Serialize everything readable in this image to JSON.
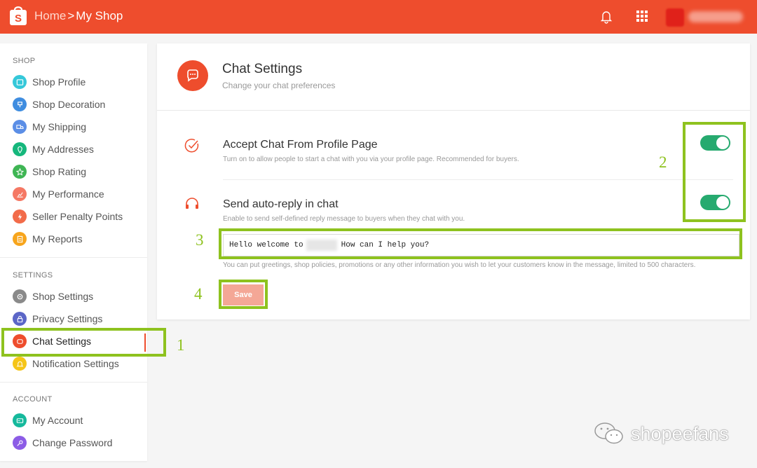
{
  "header": {
    "breadcrumb_home": "Home",
    "breadcrumb_sep": ">",
    "breadcrumb_current": "My Shop"
  },
  "sidebar": {
    "sections": [
      {
        "title": "SHOP",
        "items": [
          {
            "label": "Shop Profile",
            "icon": "profile-icon",
            "color": "#35c8d9"
          },
          {
            "label": "Shop Decoration",
            "icon": "brush-icon",
            "color": "#3f8de0"
          },
          {
            "label": "My Shipping",
            "icon": "truck-icon",
            "color": "#5b8ee6"
          },
          {
            "label": "My Addresses",
            "icon": "location-icon",
            "color": "#15b77c"
          },
          {
            "label": "Shop Rating",
            "icon": "star-icon",
            "color": "#3fb554"
          },
          {
            "label": "My Performance",
            "icon": "chart-icon",
            "color": "#f57864"
          },
          {
            "label": "Seller Penalty Points",
            "icon": "penalty-icon",
            "color": "#f26b49"
          },
          {
            "label": "My Reports",
            "icon": "report-icon",
            "color": "#f7a51c"
          }
        ]
      },
      {
        "title": "SETTINGS",
        "items": [
          {
            "label": "Shop Settings",
            "icon": "gear-icon",
            "color": "#8a8a8a"
          },
          {
            "label": "Privacy Settings",
            "icon": "lock-icon",
            "color": "#5b66c7"
          },
          {
            "label": "Chat Settings",
            "icon": "chat-icon",
            "color": "#ee4d2d"
          },
          {
            "label": "Notification Settings",
            "icon": "bell-icon",
            "color": "#f5c518"
          }
        ]
      },
      {
        "title": "ACCOUNT",
        "items": [
          {
            "label": "My Account",
            "icon": "card-icon",
            "color": "#15b99c"
          },
          {
            "label": "Change Password",
            "icon": "key-icon",
            "color": "#8c5ce6"
          }
        ]
      }
    ]
  },
  "card": {
    "title": "Chat Settings",
    "subtitle": "Change your chat preferences",
    "options": [
      {
        "title": "Accept Chat From Profile Page",
        "description": "Turn on to allow people to start a chat with you via your profile page. Recommended for buyers.",
        "enabled": true
      },
      {
        "title": "Send auto-reply in chat",
        "description": "Enable to send self-defined reply message to buyers when they chat with you.",
        "enabled": true
      }
    ],
    "reply_text_start": "Hello welcome to",
    "reply_text_end": "How can I help you?",
    "hint": "You can put greetings, shop policies, promotions or any other information you wish to let your customers know in the message, limited to 500 characters.",
    "save_label": "Save"
  },
  "annotations": {
    "n1": "1",
    "n2": "2",
    "n3": "3",
    "n4": "4",
    "color": "#8ec21f"
  },
  "watermark": "shopeefans",
  "colors": {
    "brand": "#ee4d2d",
    "toggle_on": "#26aa6f"
  }
}
